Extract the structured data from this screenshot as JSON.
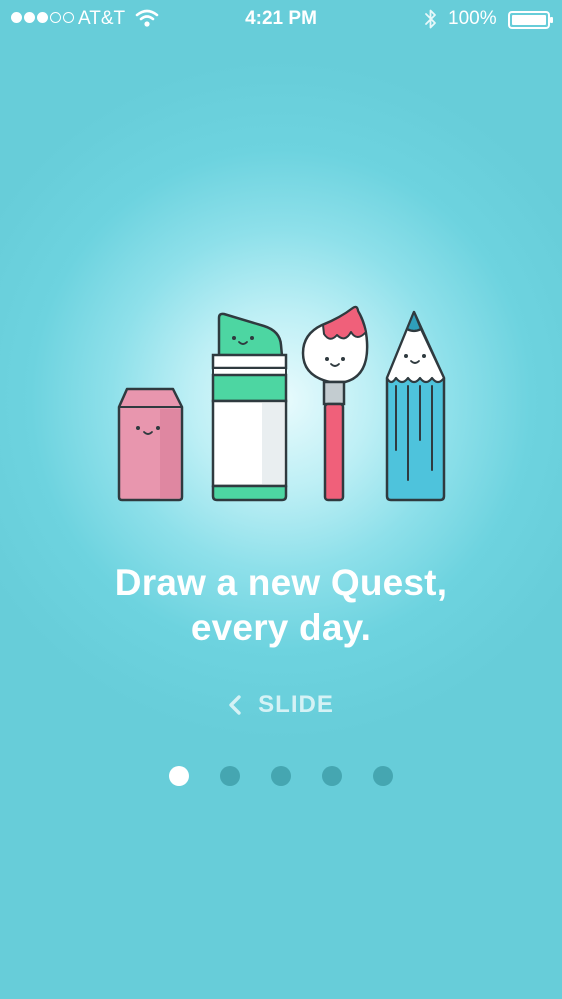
{
  "status_bar": {
    "signal_filled": 3,
    "signal_total": 5,
    "carrier": "AT&T",
    "time": "4:21 PM",
    "battery_percent": "100%",
    "icons": [
      "signal-dots",
      "wifi-icon",
      "bluetooth-icon",
      "battery-icon"
    ]
  },
  "onboarding": {
    "illustration_items": [
      "eraser",
      "marker",
      "paintbrush",
      "pencil"
    ],
    "headline_line1": "Draw a new Quest,",
    "headline_line2": "every day.",
    "slide_hint": "SLIDE",
    "slide_icon": "chevron-left-icon",
    "page_count": 5,
    "active_page": 1
  },
  "colors": {
    "background": "#67cdd9",
    "glow": "#e9fbfd",
    "eraser_pink": "#e896ae",
    "marker_green": "#4dd6a2",
    "brush_pink": "#f0607a",
    "pencil_blue": "#4ec3dc",
    "outline": "#2f3a3f",
    "dot_inactive": "#3f9fa9",
    "dot_active": "#ffffff"
  }
}
